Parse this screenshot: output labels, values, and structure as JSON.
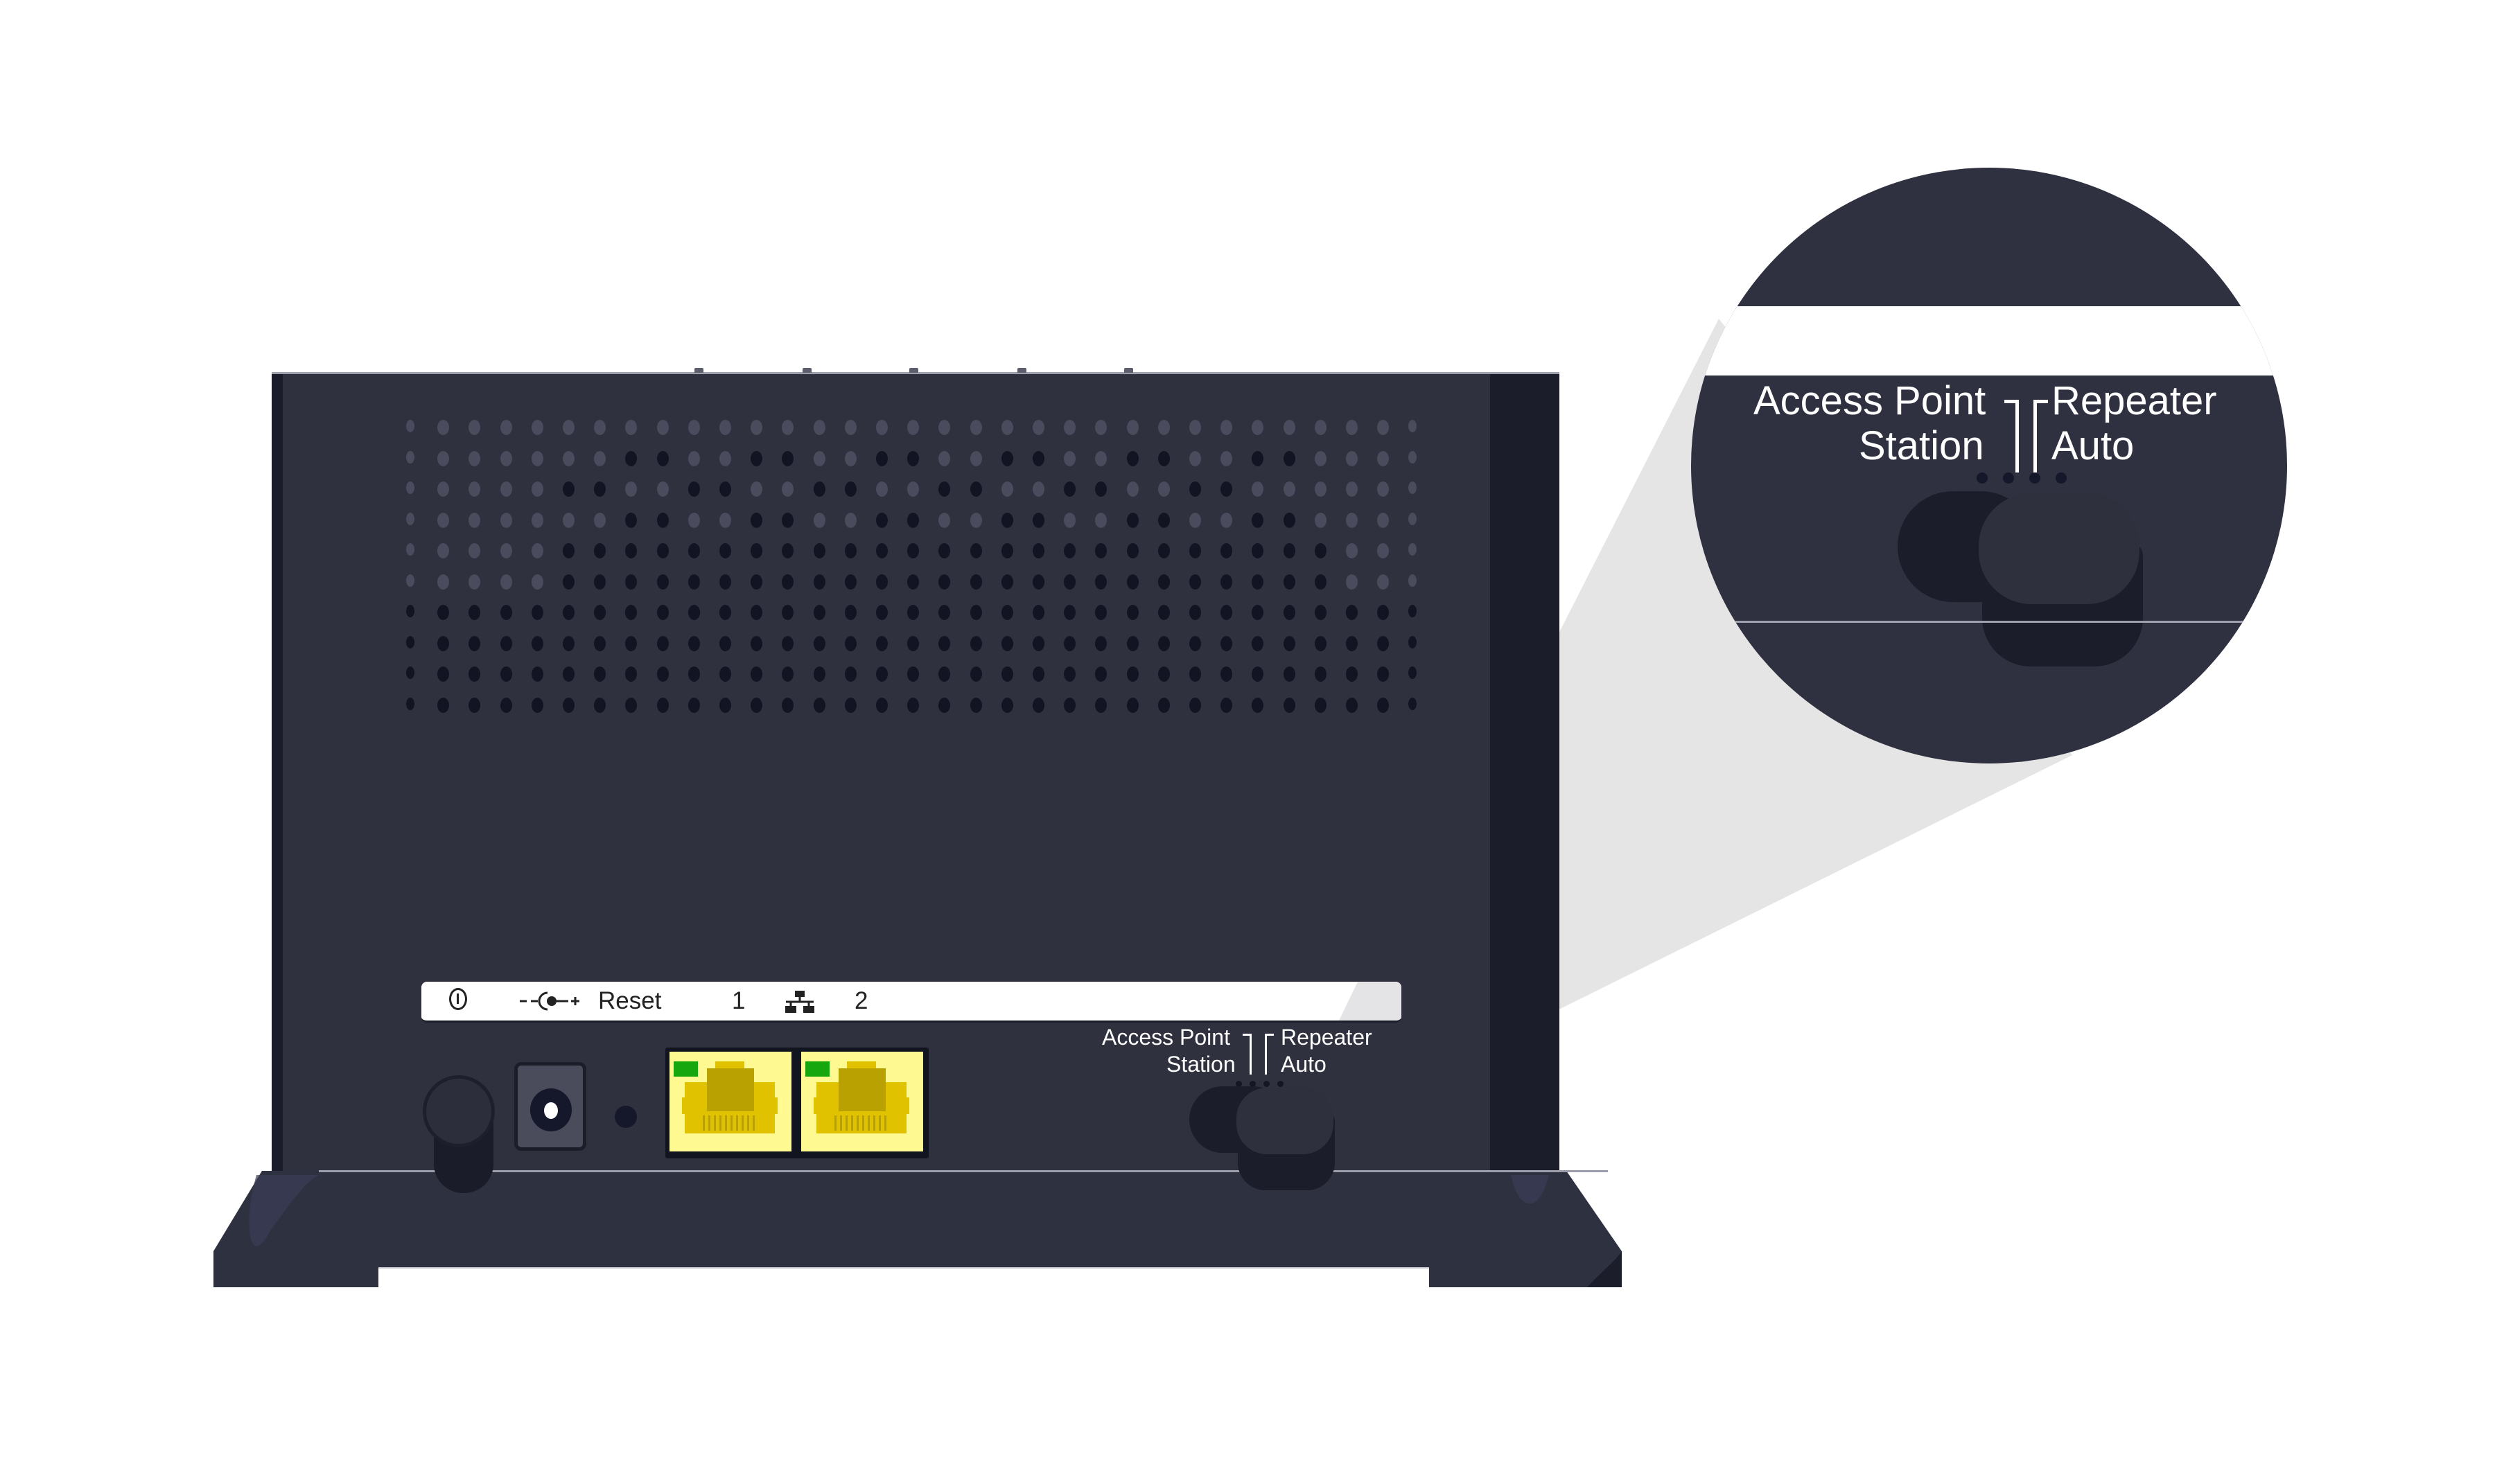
{
  "device": {
    "name": "Wireless range extender (rear view)",
    "colors": {
      "body": "#30313f",
      "side_panel": "#1b1d2b",
      "vent_light": "#4a4b5c",
      "vent_dark": "#121423",
      "label_strip": "#ffffff",
      "lan_port": "#fef991",
      "lan_jack": "#e0c200",
      "link_led": "#16a70e",
      "zoom_beam": "#e5e5e5"
    },
    "vents": {
      "columns": 33,
      "rows": 10,
      "pattern": [
        "LLLLLLLLLLLLLLLLLLLLLLLLLLLLLLLLL",
        "LLLLLLLDDLLDDLLDDLLDDLLDDLLDDLLLL",
        "LLLLLDDLLDDLLDDLLDDLLDDLLDDLLLLLL",
        "LLLLLLLDDLLDDLLDDLLDDLLDDLLDDLLLL",
        "LLLLLDDDDDDDDDDDDDDDDDDDDDDDDDLLL",
        "LLLLLDDDDDDDDDDDDDDDDDDDDDDDDDLLL",
        "DDDDDDDDDDDDDDDDDDDDDDDDDDDDDDDDD",
        "DDDDDDDDDDDDDDDDDDDDDDDDDDDDDDDDD",
        "DDDDDDDDDDDDDDDDDDDDDDDDDDDDDDDDD",
        "DDDDDDDDDDDDDDDDDDDDDDDDDDDDDDDDD"
      ]
    },
    "label_strip": {
      "power_icon": "power-icon",
      "dc_icon": "dc-polarity-icon",
      "dc_symbol": "--◐-+",
      "reset": "Reset",
      "port1": "1",
      "lan_icon": "ethernet-network-icon",
      "port2": "2"
    },
    "ports": [
      {
        "id": "lan1",
        "label": "1",
        "link_led": "on"
      },
      {
        "id": "lan2",
        "label": "2",
        "link_led": "on"
      }
    ],
    "mode_switch": {
      "positions": [
        "Access Point",
        "Station",
        "Repeater",
        "Auto"
      ],
      "label_ap": "Access Point",
      "label_station": "Station",
      "label_repeater": "Repeater",
      "label_auto": "Auto",
      "selected": "Repeater"
    }
  },
  "magnifier": {
    "label_ap": "Access Point",
    "label_station": "Station",
    "label_repeater": "Repeater",
    "label_auto": "Auto"
  }
}
